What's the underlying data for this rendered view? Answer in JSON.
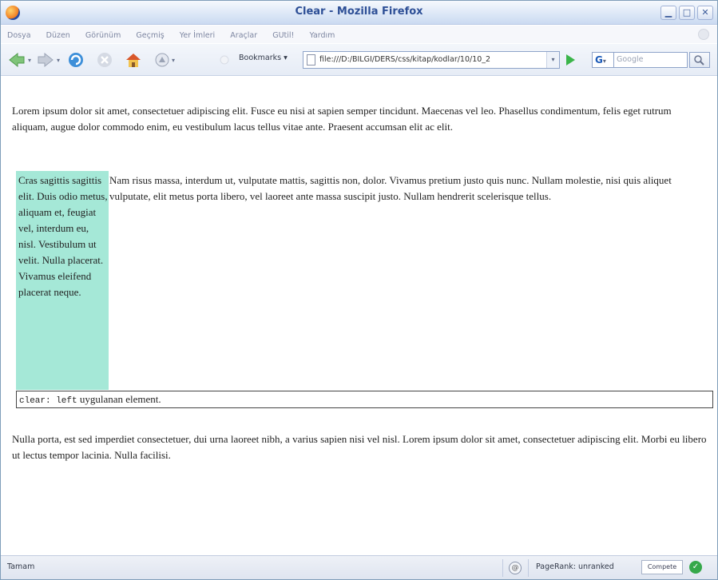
{
  "window": {
    "title": "Clear - Mozilla Firefox",
    "min_glyph": "▁",
    "max_glyph": "□",
    "close_glyph": "✕"
  },
  "menu": [
    "Dosya",
    "Düzen",
    "Görünüm",
    "Geçmiş",
    "Yer İmleri",
    "Araçlar",
    "GUtil!",
    "Yardım"
  ],
  "toolbar": {
    "bookmarks_label": "Bookmarks",
    "url": "file:///D:/BILGI/DERS/css/kitap/kodlar/10/10_2",
    "search_engine_letter": "G",
    "search_placeholder": "Google",
    "icons": [
      "back-icon",
      "forward-icon",
      "reload-icon",
      "stop-icon",
      "home-icon",
      "feed-icon",
      "go-icon",
      "search-icon"
    ]
  },
  "page": {
    "paragraph1": "Lorem ipsum dolor sit amet, consectetuer adipiscing elit. Fusce eu nisi at sapien semper tincidunt. Maecenas vel leo. Phasellus condimentum, felis eget rutrum aliquam, augue dolor commodo enim, eu vestibulum lacus tellus vitae ante. Praesent accumsan elit ac elit.",
    "float_text": "Cras sagittis sagittis elit. Duis odio metus, aliquam et, feugiat vel, interdum eu, nisl. Vestibulum ut velit. Nulla placerat. Vivamus eleifend placerat neque.",
    "paragraph2": "Nam risus massa, interdum ut, vulputate mattis, sagittis non, dolor. Vivamus pretium justo quis nunc. Nullam molestie, nisi quis aliquet vulputate, elit metus porta libero, vel laoreet ante massa suscipit justo. Nullam hendrerit scelerisque tellus.",
    "clear_code": "clear: left",
    "clear_text": " uygulanan element.",
    "paragraph3": "Nulla porta, est sed imperdiet consectetuer, dui urna laoreet nibh, a varius sapien nisi vel nisl. Lorem ipsum dolor sit amet, consectetuer adipiscing elit. Morbi eu libero ut lectus tempor lacinia. Nulla facilisi."
  },
  "status": {
    "text": "Tamam",
    "pagerank": "PageRank: unranked",
    "compete": "Compete"
  },
  "colors": {
    "float_bg": "#a5e8d7",
    "title_text": "#2d4f96"
  }
}
